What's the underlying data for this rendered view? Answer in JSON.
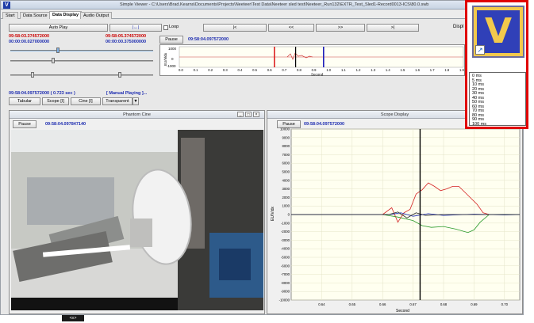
{
  "window": {
    "title": "Simple Viewer - C:\\Users\\Brad.Kearns\\Documents\\Projects\\Neeteer\\Test Data\\Neeteer sled test\\Neeteer_Run132\\EXTR_Test_Sled1-Record0013-ICS\\80.0.swb",
    "icon_letter": "V"
  },
  "tabs": [
    "Start",
    "Data Source",
    "Data Display",
    "Audio Output"
  ],
  "active_tab": "Data Display",
  "controls": {
    "auto_play": "Auto Play",
    "range_glyph": "|↔|",
    "loop": "Loop",
    "nav_start": "|<",
    "nav_back": "<<",
    "nav_forward": ">>",
    "nav_end": ">|",
    "display_label": "Displ",
    "ts_left_red": "09:58:03.374572000",
    "ts_left_blue": "00:00:00.027000000",
    "ts_right_red": "09:58:05.374572000",
    "ts_right_blue": "00:00:00.375000000",
    "current_time": "09:58:04.097572000 ( 0.723 sec )",
    "manual_mode": "[ Manual Playing ]...",
    "tab_tabular": "Tabular",
    "tab_scope": "Scope [I]",
    "tab_cine": "Cine [I]",
    "transparent": "Transparent",
    "dropdown_arrow": "▼"
  },
  "overview": {
    "pause_label": "Pause",
    "time": "09:58:04.097572000",
    "ylabel": "EU/Vidx",
    "ytick_top": "1000",
    "ytick_mid": "0",
    "ytick_bottom": "-1000",
    "xlabel": "Second",
    "xticks": [
      "0.0",
      "0.1",
      "0.2",
      "0.3",
      "0.4",
      "0.5",
      "0.6",
      "0.7",
      "0.8",
      "0.9",
      "1.0",
      "1.1",
      "1.2",
      "1.3",
      "1.4",
      "1.5",
      "1.6",
      "1.7",
      "1.8",
      "1.9"
    ]
  },
  "cine_panel": {
    "title": "Phantom Cine",
    "pause_label": "Pause",
    "time": "09:58:04.097847140"
  },
  "scope_panel": {
    "title": "Scope Display",
    "pause_label": "Pause",
    "time": "09:58:04.097572000",
    "ylabel": "EU/Vidx",
    "xlabel": "Second"
  },
  "chart_data": {
    "type": "line",
    "xlabel": "Second",
    "ylabel": "EU/Vidx",
    "ylim": [
      -10000,
      10000
    ],
    "xlim": [
      0.63,
      0.705
    ],
    "yticks": [
      10000,
      9000,
      8000,
      7000,
      6000,
      5000,
      4000,
      3000,
      2000,
      1000,
      0,
      -1000,
      -2000,
      -3000,
      -4000,
      -5000,
      -6000,
      -7000,
      -8000,
      -9000,
      -10000
    ],
    "xticks": [
      "0.64",
      "0.65",
      "0.66",
      "0.67",
      "0.68",
      "0.69",
      "0.70"
    ],
    "grid": true,
    "cursor_x": 0.6723,
    "series": [
      {
        "color": "#d42020",
        "x": [
          0.63,
          0.66,
          0.663,
          0.665,
          0.667,
          0.669,
          0.671,
          0.673,
          0.675,
          0.677,
          0.679,
          0.681,
          0.683,
          0.685,
          0.687,
          0.689,
          0.691,
          0.693,
          0.695,
          0.705
        ],
        "values": [
          0,
          0,
          800,
          -900,
          200,
          600,
          2400,
          2900,
          3700,
          3300,
          2800,
          3000,
          3300,
          3300,
          2600,
          1900,
          1200,
          200,
          0,
          0
        ]
      },
      {
        "color": "#2a9a2a",
        "x": [
          0.63,
          0.66,
          0.665,
          0.67,
          0.673,
          0.676,
          0.68,
          0.684,
          0.688,
          0.69,
          0.692,
          0.695,
          0.705
        ],
        "values": [
          0,
          0,
          -300,
          -700,
          -1300,
          -1500,
          -1400,
          -1700,
          -2100,
          -1800,
          -900,
          0,
          0
        ]
      },
      {
        "color": "#2030c0",
        "x": [
          0.63,
          0.662,
          0.666,
          0.67,
          0.675,
          0.68,
          0.69,
          0.7,
          0.705
        ],
        "values": [
          0,
          0,
          200,
          -200,
          100,
          -100,
          50,
          -50,
          0
        ]
      },
      {
        "color": "#222222",
        "x": [
          0.63,
          0.662,
          0.665,
          0.668,
          0.671,
          0.674,
          0.68,
          0.705
        ],
        "values": [
          0,
          0,
          300,
          -400,
          200,
          -100,
          0,
          0
        ]
      }
    ]
  },
  "popup": {
    "items": [
      "0 ms",
      "5 ms",
      "10 ms",
      "20 ms",
      "30 ms",
      "40 ms",
      "50 ms",
      "60 ms",
      "70 ms",
      "80 ms",
      "90 ms",
      "100 ms"
    ]
  },
  "taskbar": {
    "label": "<≡>"
  }
}
